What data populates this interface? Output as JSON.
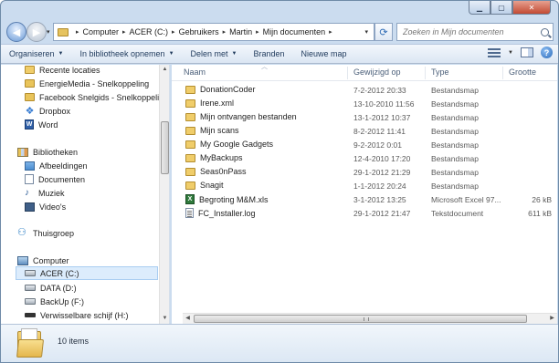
{
  "window": {
    "caption_buttons": {
      "minimize": "▁",
      "maximize": "▢",
      "close": "✕"
    }
  },
  "address": {
    "crumbs": [
      "Computer",
      "ACER (C:)",
      "Gebruikers",
      "Martin",
      "Mijn documenten"
    ],
    "separator": "▸",
    "dropdown": "▾"
  },
  "search": {
    "placeholder": "Zoeken in Mijn documenten"
  },
  "toolbar": {
    "organize": "Organiseren",
    "include_library": "In bibliotheek opnemen",
    "share": "Delen met",
    "burn": "Branden",
    "new_folder": "Nieuwe map",
    "help": "?"
  },
  "nav_pane": {
    "favorites": [
      {
        "label": "Recente locaties",
        "icon": "recent-places-icon"
      },
      {
        "label": "EnergieMedia - Snelkoppeling",
        "icon": "folder-shortcut-icon"
      },
      {
        "label": "Facebook Snelgids - Snelkoppeling",
        "icon": "folder-shortcut-icon"
      },
      {
        "label": "Dropbox",
        "icon": "dropbox-icon"
      },
      {
        "label": "Word",
        "icon": "word-icon"
      }
    ],
    "libraries_header": "Bibliotheken",
    "libraries": [
      {
        "label": "Afbeeldingen",
        "icon": "pictures-icon"
      },
      {
        "label": "Documenten",
        "icon": "documents-icon"
      },
      {
        "label": "Muziek",
        "icon": "music-icon"
      },
      {
        "label": "Video's",
        "icon": "videos-icon"
      }
    ],
    "homegroup": "Thuisgroep",
    "computer_header": "Computer",
    "drives": [
      {
        "label": "ACER (C:)",
        "selected": true
      },
      {
        "label": "DATA (D:)",
        "selected": false
      },
      {
        "label": "BackUp (F:)",
        "selected": false
      },
      {
        "label": "Verwisselbare schijf (H:)",
        "selected": false
      }
    ]
  },
  "columns": {
    "name": "Naam",
    "date": "Gewijzigd op",
    "type": "Type",
    "size": "Grootte"
  },
  "files": [
    {
      "name": "DonationCoder",
      "date": "7-2-2012 20:33",
      "type": "Bestandsmap",
      "size": "",
      "icon": "folder-icon"
    },
    {
      "name": "Irene.xml",
      "date": "13-10-2010 11:56",
      "type": "Bestandsmap",
      "size": "",
      "icon": "folder-icon"
    },
    {
      "name": "Mijn ontvangen bestanden",
      "date": "13-1-2012 10:37",
      "type": "Bestandsmap",
      "size": "",
      "icon": "folder-icon"
    },
    {
      "name": "Mijn scans",
      "date": "8-2-2012 11:41",
      "type": "Bestandsmap",
      "size": "",
      "icon": "folder-icon"
    },
    {
      "name": "My Google Gadgets",
      "date": "9-2-2012 0:01",
      "type": "Bestandsmap",
      "size": "",
      "icon": "folder-icon"
    },
    {
      "name": "MyBackups",
      "date": "12-4-2010 17:20",
      "type": "Bestandsmap",
      "size": "",
      "icon": "folder-icon"
    },
    {
      "name": "Seas0nPass",
      "date": "29-1-2012 21:29",
      "type": "Bestandsmap",
      "size": "",
      "icon": "folder-icon"
    },
    {
      "name": "Snagit",
      "date": "1-1-2012 20:24",
      "type": "Bestandsmap",
      "size": "",
      "icon": "folder-icon"
    },
    {
      "name": "Begroting M&M.xls",
      "date": "3-1-2012 13:25",
      "type": "Microsoft Excel 97...",
      "size": "26 kB",
      "icon": "excel-icon"
    },
    {
      "name": "FC_Installer.log",
      "date": "29-1-2012 21:47",
      "type": "Tekstdocument",
      "size": "611 kB",
      "icon": "text-file-icon"
    }
  ],
  "status": {
    "item_count": "10 items"
  }
}
